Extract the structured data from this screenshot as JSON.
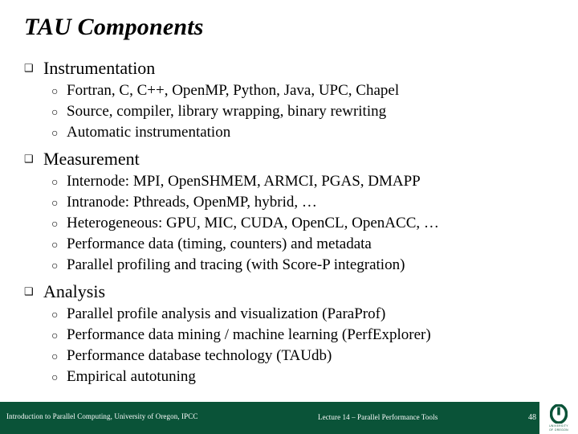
{
  "slide": {
    "title": "TAU Components",
    "markers": {
      "level1": "❑",
      "level2": "○"
    },
    "groups": [
      {
        "heading": "Instrumentation",
        "items": [
          "Fortran, C, C++, OpenMP, Python, Java, UPC, Chapel",
          "Source, compiler, library wrapping, binary rewriting",
          "Automatic instrumentation"
        ]
      },
      {
        "heading": "Measurement",
        "items": [
          "Internode: MPI, OpenSHMEM, ARMCI, PGAS, DMAPP",
          "Intranode: Pthreads, OpenMP, hybrid, …",
          "Heterogeneous: GPU, MIC, CUDA, OpenCL, OpenACC, …",
          "Performance data (timing, counters) and metadata",
          "Parallel profiling and tracing (with Score-P integration)"
        ]
      },
      {
        "heading": "Analysis",
        "items": [
          "Parallel profile analysis and visualization (ParaProf)",
          "Performance data mining / machine learning (PerfExplorer)",
          "Performance database technology (TAUdb)",
          "Empirical autotuning"
        ]
      }
    ]
  },
  "footer": {
    "left": "Introduction to Parallel Computing, University of Oregon, IPCC",
    "center": "Lecture 14 – Parallel Performance Tools",
    "page_number": "48",
    "logo": {
      "letter": "O",
      "caption_line1": "UNIVERSITY",
      "caption_line2": "OF OREGON"
    },
    "colors": {
      "bar": "#0a5338",
      "text": "#ffffff"
    }
  }
}
